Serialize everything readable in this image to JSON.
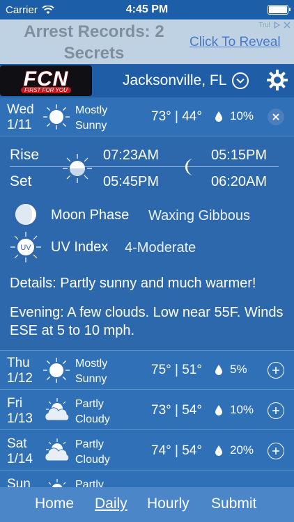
{
  "status_bar": {
    "carrier": "Carrier",
    "time": "4:45 PM"
  },
  "ad": {
    "title_line1": "Arrest Records: 2",
    "title_line2": "Secrets",
    "link": "Click To Reveal",
    "badge": "Trul"
  },
  "header": {
    "logo_text": "FCN",
    "logo_tagline": "FIRST FOR YOU",
    "location": "Jacksonville, FL",
    "icons": {
      "chevron": "chevron-down-circle-icon",
      "settings": "gear-icon"
    }
  },
  "today": {
    "weekday": "Wed",
    "date": "1/11",
    "cond_line1": "Mostly",
    "cond_line2": "Sunny",
    "high": "73°",
    "low": "44°",
    "precip": "10%",
    "icon": "mostly-sunny-icon"
  },
  "detail": {
    "rise_label": "Rise",
    "set_label": "Set",
    "sunrise": "07:23AM",
    "sunset": "05:45PM",
    "moonrise": "05:15PM",
    "moonset": "06:20AM",
    "moon_phase_label": "Moon Phase",
    "moon_phase_value": "Waxing Gibbous",
    "uv_badge": "UV",
    "uv_label": "UV Index",
    "uv_value": "4-Moderate",
    "details": "Details: Partly sunny and much warmer!",
    "evening": "Evening: A few clouds. Low near 55F. Winds ESE at 5 to 10 mph."
  },
  "forecast": [
    {
      "weekday": "Thu",
      "date": "1/12",
      "cond_line1": "Mostly",
      "cond_line2": "Sunny",
      "high": "75°",
      "low": "51°",
      "precip": "5%",
      "icon": "mostly-sunny-icon"
    },
    {
      "weekday": "Fri",
      "date": "1/13",
      "cond_line1": "Partly",
      "cond_line2": "Cloudy",
      "high": "73°",
      "low": "54°",
      "precip": "10%",
      "icon": "partly-cloudy-icon"
    },
    {
      "weekday": "Sat",
      "date": "1/14",
      "cond_line1": "Partly",
      "cond_line2": "Cloudy",
      "high": "74°",
      "low": "54°",
      "precip": "20%",
      "icon": "partly-cloudy-icon"
    },
    {
      "weekday": "Sun",
      "date": "",
      "cond_line1": "Partly",
      "cond_line2": "",
      "high": "",
      "low": "",
      "precip": "",
      "icon": "partly-cloudy-icon"
    }
  ],
  "tabs": [
    "Home",
    "Daily",
    "Hourly",
    "Submit"
  ],
  "active_tab": "Daily",
  "colors": {
    "background": "#2f70b6",
    "header": "#1f5ea7",
    "ad_bg": "#bfd2e4",
    "tab_bar": "#4a86c8"
  }
}
